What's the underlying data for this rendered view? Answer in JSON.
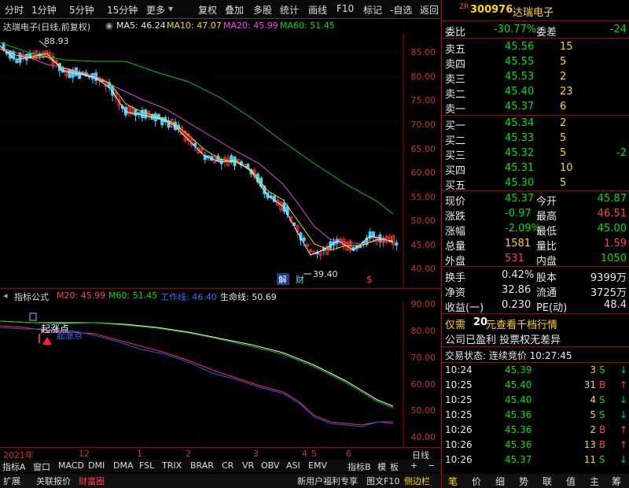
{
  "toolbar": {
    "items": [
      "分时",
      "1分钟",
      "5分钟",
      "15分钟",
      "更多",
      "复权",
      "叠加",
      "多股",
      "统计",
      "画线",
      "F10",
      "标记",
      "-自选",
      "返回"
    ]
  },
  "chart_header": {
    "title": "达瑞电子(日线,前复权)",
    "ma5": "MA5: 46.24",
    "ma10": "MA10: 47.07",
    "ma20": "MA20: 45.99",
    "ma60": "MA60: 51.45"
  },
  "price_axis": [
    "85.00",
    "80.00",
    "75.00",
    "70.00",
    "65.00",
    "60.00",
    "55.00",
    "50.00",
    "45.00",
    "40.00"
  ],
  "annotations": {
    "high": "88.93",
    "low": "39.40",
    "jie": "解",
    "cai": "财",
    "dollar": "$"
  },
  "indicator_header": {
    "title": "指标公式",
    "m20": "M20: 45.99",
    "m60": "M60: 51.45",
    "work": "工作线: 46.40",
    "life": "生命线: 50.69"
  },
  "indicator_axis": [
    "90.00",
    "80.00",
    "70.00",
    "60.00",
    "50.00",
    "40.00"
  ],
  "indicator_labels": {
    "rise": "起涨点",
    "rise2": "起涨点"
  },
  "time_axis": {
    "year": "2021年",
    "months": [
      "12",
      "1",
      "2",
      "3",
      "4",
      "5",
      "6"
    ],
    "period": "日线"
  },
  "tabs": [
    "指标A",
    "窗口",
    "MACD",
    "DMI",
    "DMA",
    "FSL",
    "TRIX",
    "BRAR",
    "CR",
    "VR",
    "OBV",
    "ASI",
    "EMV",
    "指标B",
    "模",
    "板",
    "+",
    "−"
  ],
  "bottom": {
    "left": [
      "扩展",
      "关联报价",
      "财富圈"
    ],
    "right": [
      "新用户福利专享",
      "图文F10",
      "侧边栏"
    ]
  },
  "stock": {
    "market": "ZR",
    "code": "300976",
    "name": "达瑞电子"
  },
  "weibi": {
    "label": "委比",
    "value": "-30.77%",
    "label2": "委差",
    "value2": "-24"
  },
  "asks": [
    {
      "label": "卖五",
      "price": "45.56",
      "vol": "15"
    },
    {
      "label": "卖四",
      "price": "45.55",
      "vol": "5"
    },
    {
      "label": "卖三",
      "price": "45.53",
      "vol": "2"
    },
    {
      "label": "卖二",
      "price": "45.40",
      "vol": "23"
    },
    {
      "label": "卖一",
      "price": "45.37",
      "vol": "6"
    }
  ],
  "bids": [
    {
      "label": "买一",
      "price": "45.34",
      "vol": "2",
      "chg": ""
    },
    {
      "label": "买二",
      "price": "45.33",
      "vol": "5",
      "chg": ""
    },
    {
      "label": "买三",
      "price": "45.32",
      "vol": "5",
      "chg": "-2"
    },
    {
      "label": "买四",
      "price": "45.31",
      "vol": "10",
      "chg": ""
    },
    {
      "label": "买五",
      "price": "45.30",
      "vol": "5",
      "chg": ""
    }
  ],
  "stats": [
    {
      "l1": "现价",
      "v1": "45.37",
      "l2": "今开",
      "v2": "45.87"
    },
    {
      "l1": "涨跌",
      "v1": "-0.97",
      "l2": "最高",
      "v2": "46.51"
    },
    {
      "l1": "涨幅",
      "v1": "-2.09%",
      "l2": "最低",
      "v2": "45.00"
    },
    {
      "l1": "总量",
      "v1": "1581",
      "l2": "量比",
      "v2": "1.59"
    },
    {
      "l1": "外盘",
      "v1": "531",
      "l2": "内盘",
      "v2": "1050"
    }
  ],
  "fund": [
    {
      "l1": "换手",
      "v1": "0.42%",
      "l2": "股本",
      "v2": "9399万"
    },
    {
      "l1": "净资",
      "v1": "32.86",
      "l2": "流通",
      "v2": "3725万"
    },
    {
      "l1": "收益(一)",
      "v1": "0.230",
      "l2": "PE(动)",
      "v2": "48.4"
    }
  ],
  "promo": {
    "line1a": "仅需",
    "line1b": "20",
    "line1c": "元查看千档行情",
    "line2": "公司已盈利 投票权无差异"
  },
  "trade_state": "交易状态: 连续竞价 10:27:45",
  "ticks": [
    {
      "t": "10:24",
      "p": "45.39",
      "v": "3",
      "s": "S"
    },
    {
      "t": "10:25",
      "p": "45.40",
      "v": "31",
      "s": "B"
    },
    {
      "t": "10:25",
      "p": "45.40",
      "v": "4",
      "s": "S"
    },
    {
      "t": "10:25",
      "p": "45.36",
      "v": "5",
      "s": "S"
    },
    {
      "t": "10:26",
      "p": "45.36",
      "v": "2",
      "s": "B"
    },
    {
      "t": "10:26",
      "p": "45.36",
      "v": "13",
      "s": "B"
    },
    {
      "t": "10:26",
      "p": "45.37",
      "v": "11",
      "s": "S"
    }
  ],
  "right_tabs": [
    "笔",
    "价",
    "细",
    "势",
    "联",
    "值",
    "主",
    "筹"
  ]
}
